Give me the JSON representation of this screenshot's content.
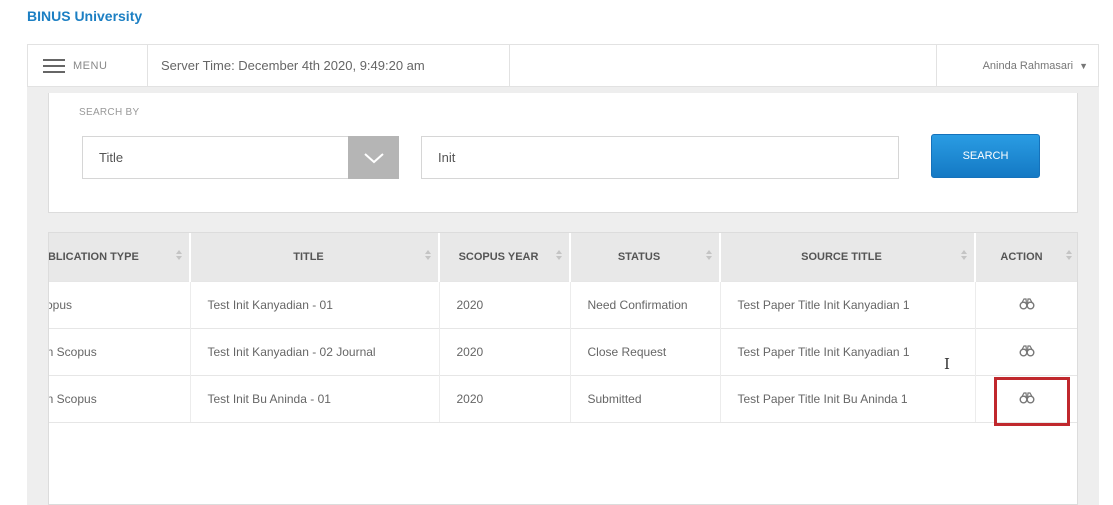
{
  "brand": "BINUS University",
  "topbar": {
    "menu_label": "MENU",
    "server_time": "Server Time: December 4th 2020, 9:49:20 am",
    "user_name": "Aninda Rahmasari"
  },
  "search": {
    "label": "SEARCH BY",
    "selected": "Title",
    "query": "Init",
    "button_label": "SEARCH"
  },
  "table": {
    "headers": [
      "UBLICATION TYPE",
      "TITLE",
      "SCOPUS YEAR",
      "STATUS",
      "SOURCE TITLE",
      "ACTION"
    ],
    "rows": [
      {
        "publication_type": "copus",
        "title": "Test Init Kanyadian - 01",
        "scopus_year": "2020",
        "status": "Need Confirmation",
        "source_title": "Test Paper Title Init Kanyadian 1"
      },
      {
        "publication_type": "on Scopus",
        "title": "Test Init Kanyadian - 02 Journal",
        "scopus_year": "2020",
        "status": "Close Request",
        "source_title": "Test Paper Title Init Kanyadian 1"
      },
      {
        "publication_type": "on Scopus",
        "title": "Test Init Bu Aninda - 01",
        "scopus_year": "2020",
        "status": "Submitted",
        "source_title": "Test Paper Title Init Bu Aninda 1"
      }
    ]
  },
  "icons": {
    "menu": "hamburger-icon",
    "user_caret": "caret-down-icon",
    "select_arrow": "chevron-down-icon",
    "sort": "sort-icon",
    "action": "binoculars-icon",
    "text_cursor": "text-cursor-icon"
  },
  "colors": {
    "brand": "#1c7fc3",
    "search_button": "#1f8bd6",
    "highlight": "#c0282d",
    "panel_background": "#eeeeee"
  }
}
